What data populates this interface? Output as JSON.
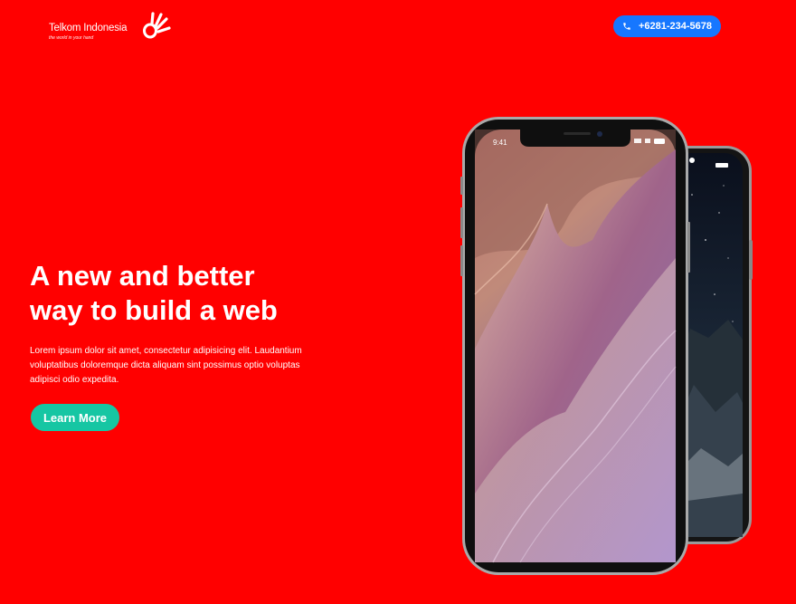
{
  "header": {
    "logo": {
      "name": "Telkom Indonesia",
      "tagline": "the world in your hand",
      "icon": "telkom-hand-icon",
      "color": "#ffffff"
    },
    "contact": {
      "icon": "phone-icon",
      "phone": "+6281-234-5678",
      "color": "#1677ff"
    }
  },
  "hero": {
    "title_line1": "A new and better",
    "title_line2": "way to build a web",
    "description": "Lorem ipsum dolor sit amet, consectetur adipisicing elit. Laudantium voluptatibus doloremque dicta aliquam sint possimus optio voluptas adipisci odio expedita.",
    "cta_label": "Learn More",
    "cta_color": "#16c6a3"
  },
  "devices": {
    "front_phone_time": "9:41",
    "front_wallpaper": "canyon-wallpaper",
    "back_wallpaper": "starry-night-wallpaper"
  },
  "theme": {
    "background": "#ff0000"
  }
}
